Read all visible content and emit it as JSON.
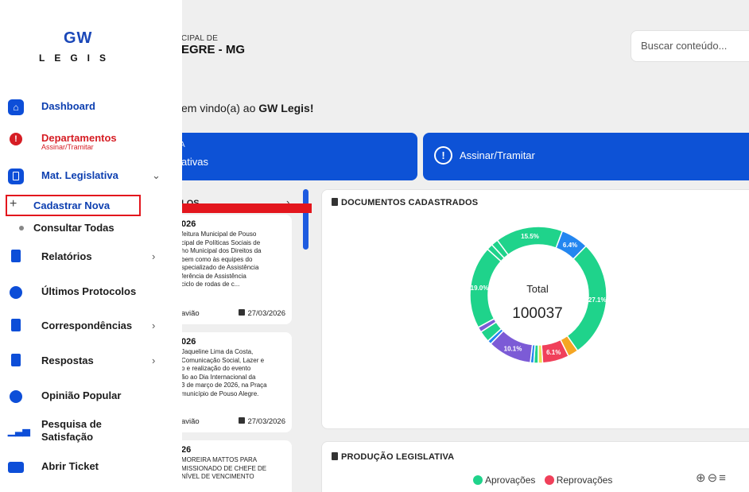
{
  "header": {
    "municipality_line1": "CIPAL DE",
    "municipality_line2": "EGRE - MG",
    "search_placeholder": "Buscar conteúdo..."
  },
  "welcome": {
    "prefix": "em vindo(a) ao ",
    "app": "GW Legis!"
  },
  "banners": {
    "left_top": "A",
    "left_label": "ativas",
    "right_label": "Assinar/Tramitar",
    "right_icon": "alert-circle-icon"
  },
  "protocols": {
    "header": "LOS",
    "cards": [
      {
        "title": "026",
        "body": "feitura Municipal de Pouso\ncipal de Políticas Sociais de\nho Municipal dos Direitos da\nbem como às equipes do\nspecializado de Assistência\nferência de Assistência\nciclo de rodas de c...",
        "author": "avião",
        "date": "27/03/2026"
      },
      {
        "title": "026",
        "body": "Jaqueline Lima da Costa,\nComunicação Social, Lazer e\no e realização do evento\não ao Dia Internacional da\n3 de março de 2026, na Praça\nmunicípio de Pouso Alegre.",
        "author": "avião",
        "date": "27/03/2026"
      },
      {
        "title": "26",
        "body": "MOREIRA MATTOS PARA\nMISSIONADO DE CHEFE DE\nNÍVEL DE VENCIMENTO",
        "author": "",
        "date": ""
      }
    ]
  },
  "documents": {
    "title": "DOCUMENTOS CADASTRADOS",
    "center_label": "Total",
    "center_value": "100037"
  },
  "production": {
    "title": "PRODUÇÃO LEGISLATIVA",
    "legend": [
      {
        "label": "Aprovações",
        "color": "#1fd38b"
      },
      {
        "label": "Reprovações",
        "color": "#f0405a"
      }
    ],
    "tools": "⊕⊖≡"
  },
  "sidebar": {
    "logo_top": "GW",
    "logo_bottom": "LEGIS",
    "items": [
      {
        "label": "Dashboard",
        "icon": "home-icon"
      },
      {
        "label": "Departamentos",
        "sublabel": "Assinar/Tramitar",
        "icon": "alert-icon"
      },
      {
        "label": "Mat. Legislativa",
        "icon": "document-icon",
        "chevron": "⌄"
      },
      {
        "label": "Relatórios",
        "icon": "report-icon",
        "chevron": "›"
      },
      {
        "label": "Últimos Protocolos",
        "icon": "clock-icon"
      },
      {
        "label": "Correspondências",
        "icon": "file-icon",
        "chevron": "›"
      },
      {
        "label": "Respostas",
        "icon": "file-icon",
        "chevron": "›"
      },
      {
        "label": "Opinião Popular",
        "icon": "chat-icon"
      },
      {
        "label": "Pesquisa de",
        "label2": "Satisfação",
        "icon": "bar-chart-icon"
      },
      {
        "label": "Abrir Ticket",
        "icon": "ticket-icon"
      }
    ],
    "subitems": [
      {
        "label": "Cadastrar Nova",
        "marker": "+"
      },
      {
        "label": "Consultar Todas",
        "marker": "•"
      }
    ]
  },
  "chart_data": {
    "type": "pie",
    "title": "DOCUMENTOS CADASTRADOS",
    "slices": [
      {
        "value": 6.4,
        "color": "#2386f0",
        "label": "6.4%"
      },
      {
        "value": 27.1,
        "color": "#1fd38b",
        "label": "27.1%"
      },
      {
        "value": 2.4,
        "color": "#f5a623",
        "label": ""
      },
      {
        "value": 6.1,
        "color": "#f0405a",
        "label": "6.1%"
      },
      {
        "value": 1.0,
        "color": "#e8e052",
        "label": ""
      },
      {
        "value": 1.0,
        "color": "#1fd38b",
        "label": ""
      },
      {
        "value": 0.8,
        "color": "#2386f0",
        "label": ""
      },
      {
        "value": 10.1,
        "color": "#7c5bd6",
        "label": "10.1%"
      },
      {
        "value": 0.9,
        "color": "#2386f0",
        "label": ""
      },
      {
        "value": 2.6,
        "color": "#1fd38b",
        "label": ""
      },
      {
        "value": 1.2,
        "color": "#7c5bd6",
        "label": ""
      },
      {
        "value": 19.0,
        "color": "#1fd38b",
        "label": "19.0%"
      },
      {
        "value": 1.4,
        "color": "#1fd38b",
        "label": ""
      },
      {
        "value": 1.6,
        "color": "#1fd38b",
        "label": ""
      },
      {
        "value": 15.5,
        "color": "#1fd38b",
        "label": "15.5%"
      }
    ],
    "center_label": "Total",
    "center_value": 100037
  }
}
